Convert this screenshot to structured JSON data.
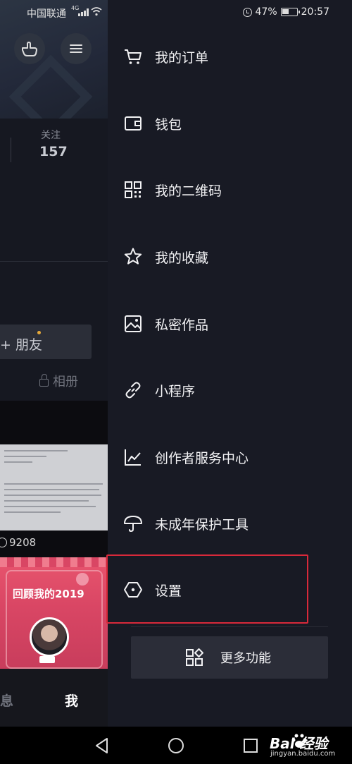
{
  "status_bar": {
    "carrier": "中国联通",
    "network": "4G",
    "battery": "47%",
    "time": "20:57"
  },
  "profile_bg": {
    "follow_label": "关注",
    "follow_count": "157",
    "friend_button": "+ 朋友",
    "album": "相册",
    "view_count": "9208",
    "review_title": "回顾我的2019",
    "tab_messages": "息",
    "tab_me": "我"
  },
  "drawer": {
    "items": [
      {
        "label": "我的订单",
        "icon": "cart-icon"
      },
      {
        "label": "钱包",
        "icon": "wallet-icon"
      },
      {
        "label": "我的二维码",
        "icon": "qrcode-icon"
      },
      {
        "label": "我的收藏",
        "icon": "star-icon"
      },
      {
        "label": "私密作品",
        "icon": "image-icon"
      },
      {
        "label": "小程序",
        "icon": "link-icon"
      },
      {
        "label": "创作者服务中心",
        "icon": "chart-icon"
      },
      {
        "label": "未成年保护工具",
        "icon": "umbrella-icon"
      },
      {
        "label": "设置",
        "icon": "hexagon-settings-icon"
      }
    ],
    "more_button": "更多功能"
  },
  "watermark": {
    "text": "Bai 经验",
    "sub": "jingyan.baidu.com"
  },
  "colors": {
    "drawer_bg": "#181a24",
    "highlight": "#d8293a",
    "more_bg": "#2b2d38"
  }
}
